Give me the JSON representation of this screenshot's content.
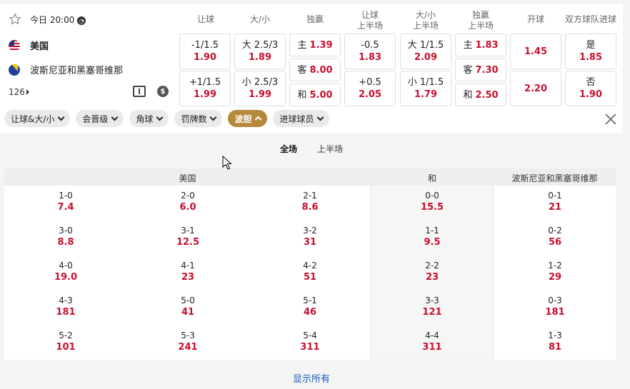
{
  "match": {
    "time": "今日 20:00",
    "home": "美国",
    "away": "波斯尼亚和黑塞哥维那",
    "more_count": "126"
  },
  "columns": [
    "让球",
    "大/小",
    "独赢",
    "让球\n上半场",
    "大/小\n上半场",
    "独赢\n上半场",
    "开球",
    "双方球队进球"
  ],
  "odds": {
    "hcap_home": {
      "label": "-1/1.5",
      "value": "1.90"
    },
    "hcap_away": {
      "label": "+1/1.5",
      "value": "1.99"
    },
    "ou_over": {
      "label": "大 2.5/3",
      "value": "1.89"
    },
    "ou_under": {
      "label": "小 2.5/3",
      "value": "1.99"
    },
    "ml_home": {
      "label": "主",
      "value": "1.39"
    },
    "ml_away": {
      "label": "客",
      "value": "8.00"
    },
    "ml_draw": {
      "label": "和",
      "value": "5.00"
    },
    "h1_hcap_home": {
      "label": "-0.5",
      "value": "1.83"
    },
    "h1_hcap_away": {
      "label": "+0.5",
      "value": "2.05"
    },
    "h1_ou_over": {
      "label": "大 1/1.5",
      "value": "2.09"
    },
    "h1_ou_under": {
      "label": "小 1/1.5",
      "value": "1.79"
    },
    "h1_ml_home": {
      "label": "主",
      "value": "1.83"
    },
    "h1_ml_away": {
      "label": "客",
      "value": "7.30"
    },
    "h1_ml_draw": {
      "label": "和",
      "value": "2.50"
    },
    "kickoff_1": {
      "value": "1.45"
    },
    "kickoff_2": {
      "value": "2.20"
    },
    "btts_yes": {
      "label": "是",
      "value": "1.85"
    },
    "btts_no": {
      "label": "否",
      "value": "1.90"
    }
  },
  "filters": [
    {
      "label": "让球&大/小",
      "active": false
    },
    {
      "label": "会晋级",
      "active": false
    },
    {
      "label": "角球",
      "active": false
    },
    {
      "label": "罚牌数",
      "active": false
    },
    {
      "label": "波胆",
      "active": true
    },
    {
      "label": "进球球员",
      "active": false
    }
  ],
  "period_tabs": [
    "全场",
    "上半场"
  ],
  "correct_score": {
    "headers": {
      "home": "美国",
      "draw": "和",
      "away": "波斯尼亚和黑塞哥维那"
    },
    "home_cols": [
      [
        {
          "score": "1-0",
          "odd": "7.4"
        },
        {
          "score": "3-0",
          "odd": "8.8"
        },
        {
          "score": "4-0",
          "odd": "19.0"
        },
        {
          "score": "4-3",
          "odd": "181"
        },
        {
          "score": "5-2",
          "odd": "101"
        }
      ],
      [
        {
          "score": "2-0",
          "odd": "6.0"
        },
        {
          "score": "3-1",
          "odd": "12.5"
        },
        {
          "score": "4-1",
          "odd": "23"
        },
        {
          "score": "5-0",
          "odd": "41"
        },
        {
          "score": "5-3",
          "odd": "241"
        }
      ],
      [
        {
          "score": "2-1",
          "odd": "8.6"
        },
        {
          "score": "3-2",
          "odd": "31"
        },
        {
          "score": "4-2",
          "odd": "51"
        },
        {
          "score": "5-1",
          "odd": "46"
        },
        {
          "score": "5-4",
          "odd": "311"
        }
      ]
    ],
    "draw_col": [
      {
        "score": "0-0",
        "odd": "15.5"
      },
      {
        "score": "1-1",
        "odd": "9.5"
      },
      {
        "score": "2-2",
        "odd": "23"
      },
      {
        "score": "3-3",
        "odd": "121"
      },
      {
        "score": "4-4",
        "odd": "311"
      }
    ],
    "away_col": [
      {
        "score": "0-1",
        "odd": "21"
      },
      {
        "score": "0-2",
        "odd": "56"
      },
      {
        "score": "1-2",
        "odd": "29"
      },
      {
        "score": "0-3",
        "odd": "181"
      },
      {
        "score": "1-3",
        "odd": "81"
      }
    ]
  },
  "show_all": "显示所有",
  "colors": {
    "accent": "#b5893a",
    "odd_red": "#c8102e",
    "link": "#1a5fb4"
  },
  "icons": [
    "star-icon",
    "clock-icon",
    "us-flag-icon",
    "bih-flag-icon",
    "field-icon",
    "coin-icon",
    "close-icon",
    "cursor-icon"
  ]
}
